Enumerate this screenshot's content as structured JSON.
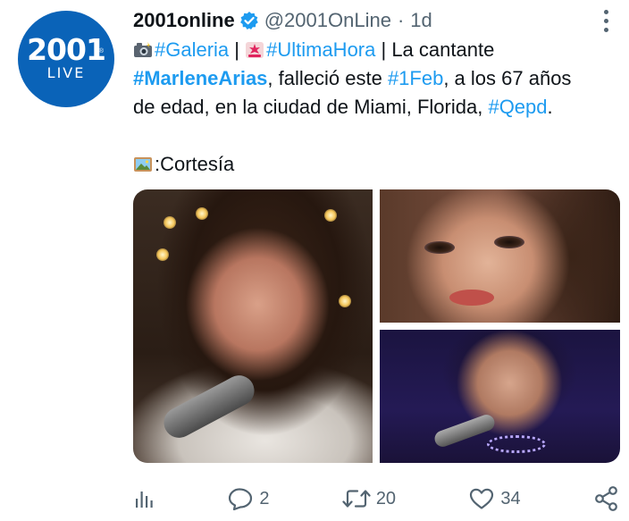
{
  "tweet": {
    "avatar": {
      "line1": "2001",
      "line2": "LIVE",
      "reg": "®"
    },
    "author_name": "2001online",
    "handle": "@2001OnLine",
    "separator": "·",
    "time": "1d",
    "text": {
      "tag_galeria": "#Galeria",
      "pipe1": " | ",
      "tag_ultimahora": "#UltimaHora",
      "pipe2": " |  La cantante",
      "tag_marlene": "#MarleneArias",
      "mid1": ", falleció este ",
      "tag_1feb": "#1Feb",
      "mid2": ", a los 67 años",
      "line3_start": "de edad, en la ciudad de Miami, Florida, ",
      "tag_qepd": "#Qepd",
      "line3_end": ".",
      "credit": ":Cortesía"
    },
    "icons": {
      "verified": "verified-badge-icon",
      "camera": "camera-flash-icon",
      "siren": "police-light-icon",
      "framed_picture": "framed-picture-icon"
    },
    "colors": {
      "link": "#1d9bf0",
      "text": "#0f1419",
      "muted": "#536471",
      "avatar_bg": "#0a63b8"
    }
  },
  "actions": {
    "analytics": {
      "icon": "analytics-icon"
    },
    "reply": {
      "icon": "reply-icon",
      "count": "2"
    },
    "retweet": {
      "icon": "retweet-icon",
      "count": "20"
    },
    "like": {
      "icon": "heart-icon",
      "count": "34"
    },
    "share": {
      "icon": "share-icon"
    }
  }
}
